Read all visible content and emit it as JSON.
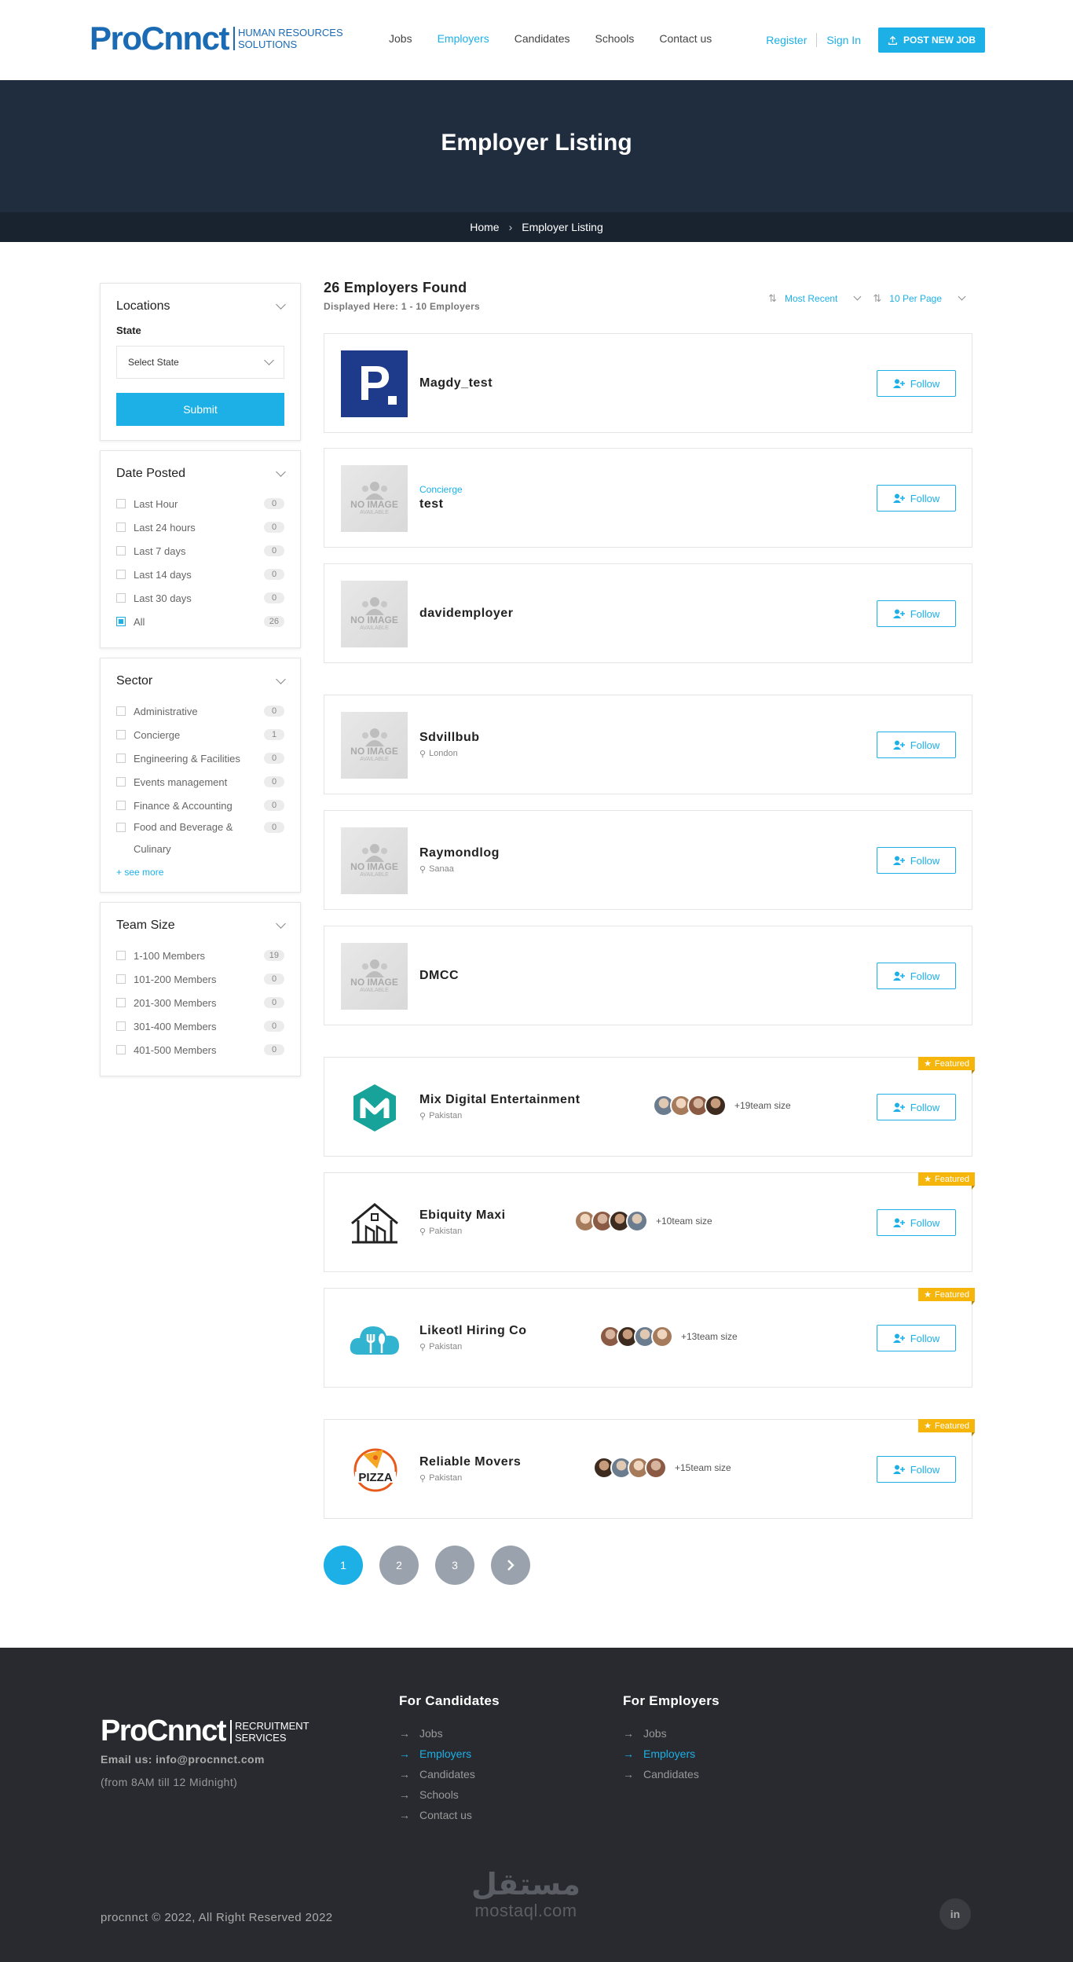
{
  "header": {
    "logo_main": "ProCnnct",
    "logo_sub_1": "HUMAN RESOURCES",
    "logo_sub_2": "SOLUTIONS",
    "nav": [
      "Jobs",
      "Employers",
      "Candidates",
      "Schools",
      "Contact us"
    ],
    "nav_active": "Employers",
    "register": "Register",
    "sign_in": "Sign In",
    "post_job": "POST NEW JOB"
  },
  "hero": {
    "title": "Employer Listing"
  },
  "breadcrumb": {
    "home": "Home",
    "current": "Employer Listing"
  },
  "sidebar": {
    "locations": {
      "title": "Locations",
      "state_label": "State",
      "select_value": "Select State",
      "submit": "Submit"
    },
    "date_posted": {
      "title": "Date Posted",
      "items": [
        {
          "label": "Last Hour",
          "count": "0",
          "checked": false
        },
        {
          "label": "Last 24 hours",
          "count": "0",
          "checked": false
        },
        {
          "label": "Last 7 days",
          "count": "0",
          "checked": false
        },
        {
          "label": "Last 14 days",
          "count": "0",
          "checked": false
        },
        {
          "label": "Last 30 days",
          "count": "0",
          "checked": false
        },
        {
          "label": "All",
          "count": "26",
          "checked": true
        }
      ]
    },
    "sector": {
      "title": "Sector",
      "items": [
        {
          "label": "Administrative",
          "count": "0"
        },
        {
          "label": "Concierge",
          "count": "1"
        },
        {
          "label": "Engineering & Facilities",
          "count": "0"
        },
        {
          "label": "Events management",
          "count": "0"
        },
        {
          "label": "Finance & Accounting",
          "count": "0"
        },
        {
          "label": "Food and Beverage & Culinary",
          "count": "0"
        }
      ],
      "see_more": "+ see more"
    },
    "team_size": {
      "title": "Team Size",
      "items": [
        {
          "label": "1-100 Members",
          "count": "19"
        },
        {
          "label": "101-200 Members",
          "count": "0"
        },
        {
          "label": "201-300 Members",
          "count": "0"
        },
        {
          "label": "301-400 Members",
          "count": "0"
        },
        {
          "label": "401-500 Members",
          "count": "0"
        }
      ]
    }
  },
  "listing": {
    "count": "26 Employers Found",
    "displayed": "Displayed Here: 1 - 10 Employers",
    "sort": "Most Recent",
    "per_page": "10 Per Page",
    "follow_label": "Follow",
    "featured_label": "Featured",
    "employers": [
      {
        "name": "Magdy_test",
        "sector": "",
        "location": "",
        "logo": "p-logo",
        "featured": false,
        "team_size": ""
      },
      {
        "name": "test",
        "sector": "Concierge",
        "location": "",
        "logo": "no-image",
        "featured": false,
        "team_size": ""
      },
      {
        "name": "davidemployer",
        "sector": "",
        "location": "",
        "logo": "no-image",
        "featured": false,
        "team_size": ""
      },
      {
        "name": "Sdvillbub",
        "sector": "",
        "location": "London",
        "logo": "no-image",
        "featured": false,
        "team_size": ""
      },
      {
        "name": "Raymondlog",
        "sector": "",
        "location": "Sanaa",
        "logo": "no-image",
        "featured": false,
        "team_size": ""
      },
      {
        "name": "DMCC",
        "sector": "",
        "location": "",
        "logo": "no-image",
        "featured": false,
        "team_size": ""
      },
      {
        "name": "Mix Digital Entertainment",
        "sector": "",
        "location": "Pakistan",
        "logo": "m-logo",
        "featured": true,
        "team_size": "+19team size"
      },
      {
        "name": "Ebiquity Maxi",
        "sector": "",
        "location": "Pakistan",
        "logo": "house-logo",
        "featured": true,
        "team_size": "+10team size"
      },
      {
        "name": "Likeotl Hiring Co",
        "sector": "",
        "location": "Pakistan",
        "logo": "cloud-fork-logo",
        "featured": true,
        "team_size": "+13team size"
      },
      {
        "name": "Reliable Movers",
        "sector": "",
        "location": "Pakistan",
        "logo": "pizza-logo",
        "featured": true,
        "team_size": "+15team size"
      }
    ]
  },
  "pagination": [
    "1",
    "2",
    "3"
  ],
  "footer": {
    "logo_main": "ProCnnct",
    "logo_sub_1": "RECRUITMENT",
    "logo_sub_2": "SERVICES",
    "email": "Email us: info@procnnct.com",
    "hours": "(from 8AM till 12 Midnight)",
    "candidates_title": "For Candidates",
    "candidates_links": [
      "Jobs",
      "Employers",
      "Candidates",
      "Schools",
      "Contact us"
    ],
    "employers_title": "For Employers",
    "employers_links": [
      "Jobs",
      "Employers",
      "Candidates"
    ],
    "copyright": "procnnct © 2022, All Right Reserved 2022",
    "watermark_ar": "مستقل",
    "watermark_en": "mostaql.com",
    "social": "in"
  },
  "colors": {
    "accent": "#1cb0e6",
    "hero": "#1f2d3f",
    "footer": "#282a2f",
    "featured": "#f5b50a"
  }
}
